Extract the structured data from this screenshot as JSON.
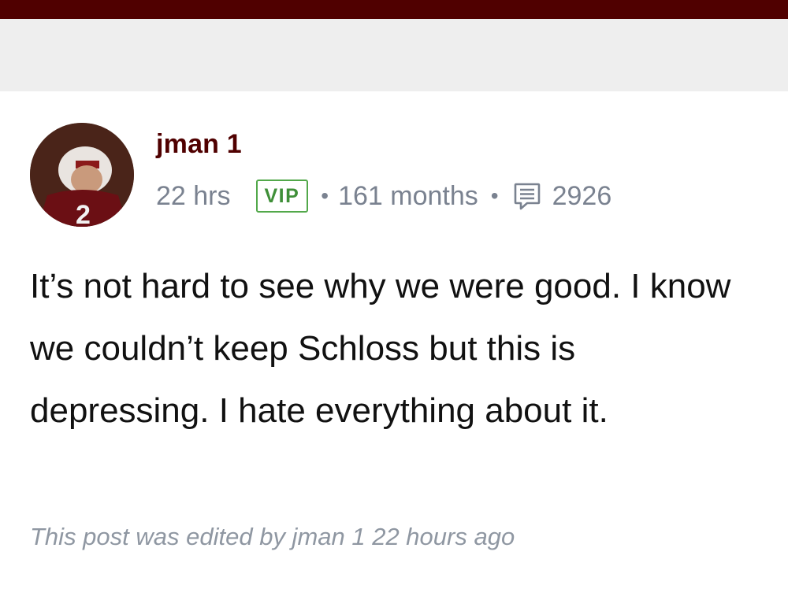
{
  "post": {
    "username": "jman 1",
    "time": "22 hrs",
    "badge": "VIP",
    "tenure": "161 months",
    "separator": "•",
    "post_count": "2926",
    "body": "It’s not hard to see why we were good. I know we couldn’t keep Schloss but this is depressing. I hate everything about it.",
    "edited_note": "This post was edited by jman 1 22 hours ago"
  },
  "icons": {
    "avatar": "avatar-photo",
    "messages": "message-lines-icon"
  },
  "colors": {
    "header_bar": "#500000",
    "username": "#500000",
    "vip_badge": "#52a84a",
    "meta_text": "#7a8290",
    "body_text": "#111111",
    "edited_text": "#8f97a2"
  }
}
